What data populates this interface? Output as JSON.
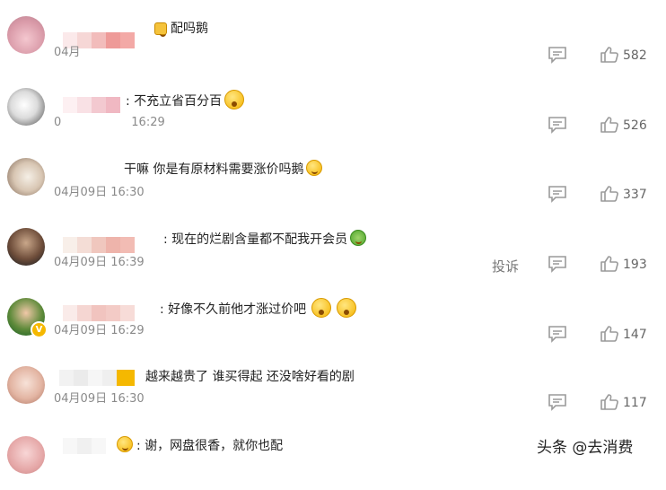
{
  "comments": [
    {
      "text": "配吗鹅",
      "time": "04月",
      "likes": "582"
    },
    {
      "text": "不充立省百分百",
      "time": "0",
      "time_tail": "16:29",
      "likes": "526"
    },
    {
      "text": "干嘛 你是有原材料需要涨价吗鹅",
      "time": "04月09日 16:30",
      "likes": "337"
    },
    {
      "text": "现在的烂剧含量都不配我开会员",
      "time": "04月09日 16:39",
      "likes": "193",
      "report": "投诉"
    },
    {
      "text": "好像不久前他才涨过价吧",
      "time": "04月09日 16:29",
      "likes": "147"
    },
    {
      "text": "越来越贵了 谁买得起 还没啥好看的剧",
      "time": "04月09日 16:30",
      "likes": "117"
    },
    {
      "text": "谢，网盘很香，就你也配",
      "time": ""
    }
  ],
  "watermark": "头条 @去消费",
  "icons": {
    "comment": "comment-bubble-icon",
    "like": "thumbs-up-icon",
    "emoji": "emoji-icon",
    "verified": "verified-badge-icon"
  },
  "colors": {
    "text": "#222222",
    "meta": "#8a8a8a",
    "icon": "#9a9a9a",
    "badge": "#f5b800"
  }
}
